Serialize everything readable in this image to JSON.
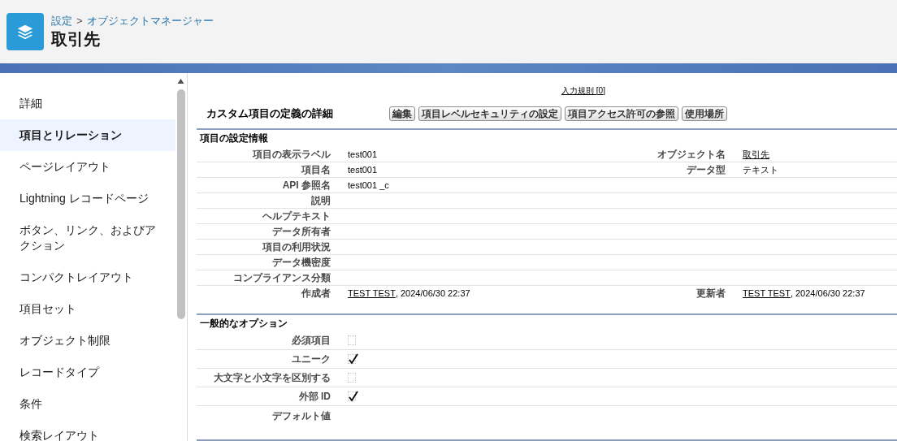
{
  "header": {
    "breadcrumb": [
      {
        "text": "設定"
      },
      {
        "text": "オブジェクトマネージャー"
      }
    ],
    "separator": ">",
    "title": "取引先"
  },
  "sidebar": {
    "items": [
      {
        "label": "詳細",
        "selected": false
      },
      {
        "label": "項目とリレーション",
        "selected": true
      },
      {
        "label": "ページレイアウト",
        "selected": false
      },
      {
        "label": "Lightning レコードページ",
        "selected": false
      },
      {
        "label": "ボタン、リンク、およびアクション",
        "selected": false
      },
      {
        "label": "コンパクトレイアウト",
        "selected": false
      },
      {
        "label": "項目セット",
        "selected": false
      },
      {
        "label": "オブジェクト制限",
        "selected": false
      },
      {
        "label": "レコードタイプ",
        "selected": false
      },
      {
        "label": "条件",
        "selected": false
      },
      {
        "label": "検索レイアウト",
        "selected": false
      }
    ]
  },
  "related_link": "入力規則 [0]",
  "detail": {
    "title": "カスタム項目の定義の詳細",
    "buttons": [
      "編集",
      "項目レベルセキュリティの設定",
      "項目アクセス許可の参照",
      "使用場所"
    ]
  },
  "settings": {
    "heading": "項目の設定情報",
    "rows": [
      {
        "label": "項目の表示ラベル",
        "value": "test001",
        "label2": "オブジェクト名",
        "value2_link": "取引先"
      },
      {
        "label": "項目名",
        "value": "test001",
        "label2": "データ型",
        "value2": "テキスト"
      },
      {
        "label": "API 参照名",
        "value": "test001 _c"
      },
      {
        "label": "説明"
      },
      {
        "label": "ヘルプテキスト"
      },
      {
        "label": "データ所有者"
      },
      {
        "label": "項目の利用状況"
      },
      {
        "label": "データ機密度"
      },
      {
        "label": "コンプライアンス分類"
      },
      {
        "label": "作成者",
        "value_link": "TEST TEST",
        "value": ", 2024/06/30 22:37",
        "label2": "更新者",
        "value2_link": "TEST TEST",
        "value2": ", 2024/06/30 22:37"
      }
    ]
  },
  "options": {
    "heading": "一般的なオプション",
    "rows": [
      {
        "label": "必須項目",
        "kind": "checkbox",
        "checked": false
      },
      {
        "label": "ユニーク",
        "kind": "checkbox",
        "checked": true
      },
      {
        "label": "大文字と小文字を区別する",
        "kind": "checkbox",
        "checked": false
      },
      {
        "label": "外部 ID",
        "kind": "checkbox",
        "checked": true
      },
      {
        "label": "デフォルト値",
        "kind": "text"
      }
    ]
  }
}
